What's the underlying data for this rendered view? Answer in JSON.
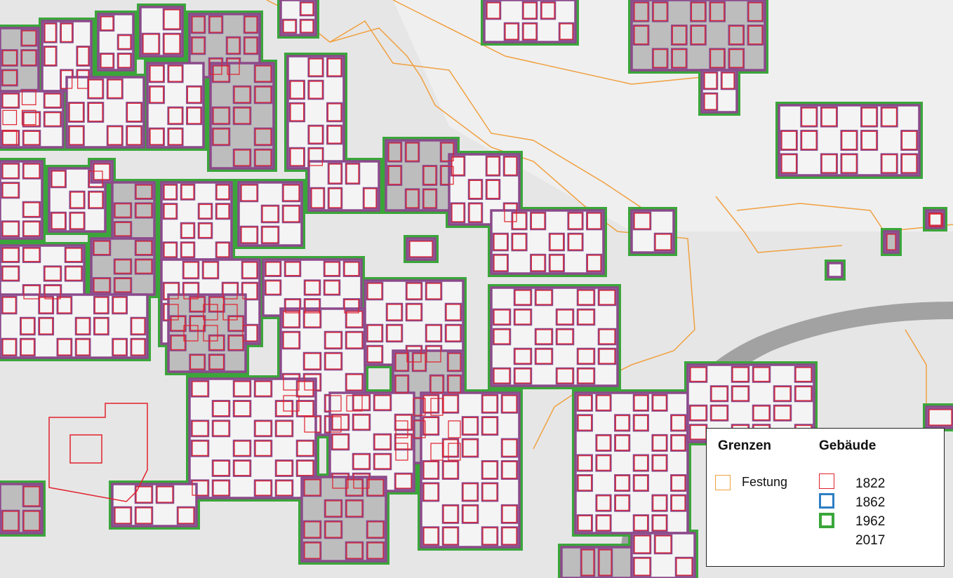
{
  "map": {
    "colors": {
      "background": "#e6e6e6",
      "river": "#9a9a9a",
      "festung": "#f0a040",
      "b1822": "#e0202c",
      "b1862": "#2e7ec4",
      "b1962": "#3aa63a",
      "b2017": "#8b4a8b",
      "fill2017": "#bdbdbd"
    },
    "icons": [
      "festung-line-icon",
      "building-1822-swatch-icon",
      "building-1862-swatch-icon",
      "building-1962-swatch-icon"
    ]
  },
  "legend": {
    "grenzen": {
      "title": "Grenzen",
      "items": [
        {
          "label": "Festung",
          "color": "#f0a040"
        }
      ]
    },
    "gebaeude": {
      "title": "Gebäude",
      "items": [
        {
          "label": "1822",
          "color": "#e0202c"
        },
        {
          "label": "1862",
          "color": "#2e7ec4"
        },
        {
          "label": "1962",
          "color": "#3aa63a"
        },
        {
          "label": "2017",
          "color": ""
        }
      ]
    }
  }
}
